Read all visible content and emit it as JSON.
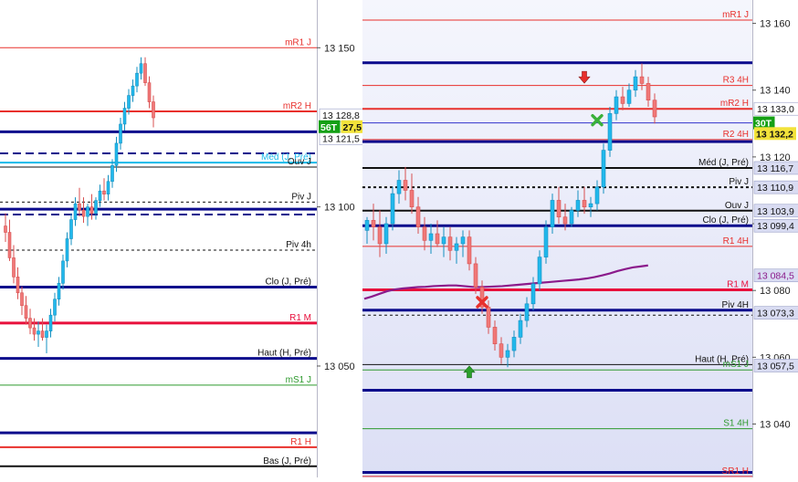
{
  "chart_data": [
    {
      "type": "candlestick",
      "title": "",
      "ylim": [
        13015,
        13165
      ],
      "y_ticks": [
        "13 150",
        "13 100",
        "13 050"
      ],
      "levels": [
        {
          "label": "mR1 J",
          "value": 13150,
          "color": "#e8302c",
          "width": 1,
          "style": "solid"
        },
        {
          "label": "mR2 H",
          "value": 13130,
          "color": "#e8302c",
          "width": 2,
          "style": "solid"
        },
        {
          "label": "",
          "value": 13123.6,
          "color": "#0a0a8c",
          "width": 3,
          "style": "solid"
        },
        {
          "label": "",
          "value": 13116.8,
          "color": "#0a0a8c",
          "width": 2,
          "style": "dash"
        },
        {
          "label": "Méd (J, Pré)",
          "value": 13113.9,
          "color": "#18b8e8",
          "width": 2,
          "style": "solid"
        },
        {
          "label": "Ouv J",
          "value": 13112.5,
          "color": "#111111",
          "width": 1,
          "style": "solid"
        },
        {
          "label": "Piv J",
          "value": 13101.5,
          "color": "#111111",
          "width": 1,
          "style": "dot"
        },
        {
          "label": "",
          "value": 13099.3,
          "color": "#0a0a8c",
          "width": 3,
          "style": "solid"
        },
        {
          "label": "",
          "value": 13097.6,
          "color": "#0a0a8c",
          "width": 2,
          "style": "dash"
        },
        {
          "label": "Piv 4h",
          "value": 13086.4,
          "color": "#111111",
          "width": 1,
          "style": "dot"
        },
        {
          "label": "Clo (J, Pré)",
          "value": 13074.8,
          "color": "#0a0a8c",
          "width": 3,
          "style": "solid"
        },
        {
          "label": "R1 M",
          "value": 13063.5,
          "color": "#e8103c",
          "width": 3,
          "style": "solid"
        },
        {
          "label": "Haut (H, Pré)",
          "value": 13052.4,
          "color": "#0a0a8c",
          "width": 3,
          "style": "solid"
        },
        {
          "label": "mS1 J",
          "value": 13044,
          "color": "#2e9a2e",
          "width": 1,
          "style": "solid"
        },
        {
          "label": "",
          "value": 13029,
          "color": "#0a0a8c",
          "width": 3,
          "style": "solid"
        },
        {
          "label": "R1 H",
          "value": 13024.5,
          "color": "#e8302c",
          "width": 2,
          "style": "solid"
        },
        {
          "label": "Bas (J, Pré)",
          "value": 13018.5,
          "color": "#111111",
          "width": 2,
          "style": "solid"
        }
      ],
      "price_tags": [
        {
          "text": "13 128,8",
          "value": 13128.8,
          "bg": "#ffffff",
          "fg": "#111111"
        },
        {
          "text": "13 121,5",
          "value": 13121.5,
          "bg": "#ffffff",
          "fg": "#111111"
        }
      ],
      "timer_badges": [
        {
          "text": "56T",
          "value": 13125.2,
          "bg": "#15a015",
          "fg": "#ffffff"
        },
        {
          "text": "27,5",
          "value": 13125.2,
          "bg": "#f2e23a",
          "fg": "#111111"
        }
      ],
      "candles": [
        {
          "o": 13094,
          "h": 13098,
          "l": 13089,
          "c": 13092
        },
        {
          "o": 13092,
          "h": 13096,
          "l": 13083,
          "c": 13084
        },
        {
          "o": 13084,
          "h": 13088,
          "l": 13076,
          "c": 13078
        },
        {
          "o": 13078,
          "h": 13081,
          "l": 13071,
          "c": 13073
        },
        {
          "o": 13073,
          "h": 13075,
          "l": 13066,
          "c": 13069
        },
        {
          "o": 13069,
          "h": 13072,
          "l": 13063,
          "c": 13065
        },
        {
          "o": 13065,
          "h": 13068,
          "l": 13060,
          "c": 13062
        },
        {
          "o": 13062,
          "h": 13065,
          "l": 13058,
          "c": 13060
        },
        {
          "o": 13060,
          "h": 13064,
          "l": 13056,
          "c": 13061
        },
        {
          "o": 13061,
          "h": 13065,
          "l": 13058,
          "c": 13059
        },
        {
          "o": 13059,
          "h": 13063,
          "l": 13054,
          "c": 13061
        },
        {
          "o": 13061,
          "h": 13068,
          "l": 13059,
          "c": 13066
        },
        {
          "o": 13066,
          "h": 13073,
          "l": 13064,
          "c": 13071
        },
        {
          "o": 13071,
          "h": 13078,
          "l": 13069,
          "c": 13076
        },
        {
          "o": 13076,
          "h": 13085,
          "l": 13074,
          "c": 13083
        },
        {
          "o": 13083,
          "h": 13092,
          "l": 13081,
          "c": 13090
        },
        {
          "o": 13090,
          "h": 13098,
          "l": 13088,
          "c": 13096
        },
        {
          "o": 13096,
          "h": 13103,
          "l": 13094,
          "c": 13101
        },
        {
          "o": 13101,
          "h": 13106,
          "l": 13097,
          "c": 13099
        },
        {
          "o": 13099,
          "h": 13103,
          "l": 13095,
          "c": 13097
        },
        {
          "o": 13097,
          "h": 13101,
          "l": 13094,
          "c": 13100
        },
        {
          "o": 13100,
          "h": 13104,
          "l": 13096,
          "c": 13098
        },
        {
          "o": 13098,
          "h": 13103,
          "l": 13096,
          "c": 13102
        },
        {
          "o": 13102,
          "h": 13107,
          "l": 13100,
          "c": 13105
        },
        {
          "o": 13105,
          "h": 13109,
          "l": 13102,
          "c": 13104
        },
        {
          "o": 13104,
          "h": 13110,
          "l": 13102,
          "c": 13108
        },
        {
          "o": 13108,
          "h": 13115,
          "l": 13106,
          "c": 13113
        },
        {
          "o": 13113,
          "h": 13122,
          "l": 13111,
          "c": 13120
        },
        {
          "o": 13120,
          "h": 13128,
          "l": 13118,
          "c": 13126
        },
        {
          "o": 13126,
          "h": 13133,
          "l": 13124,
          "c": 13131
        },
        {
          "o": 13131,
          "h": 13137,
          "l": 13129,
          "c": 13135
        },
        {
          "o": 13135,
          "h": 13140,
          "l": 13133,
          "c": 13138
        },
        {
          "o": 13138,
          "h": 13144,
          "l": 13136,
          "c": 13142
        },
        {
          "o": 13142,
          "h": 13147,
          "l": 13140,
          "c": 13145
        },
        {
          "o": 13145,
          "h": 13147,
          "l": 13138,
          "c": 13139
        },
        {
          "o": 13139,
          "h": 13141,
          "l": 13131,
          "c": 13133
        },
        {
          "o": 13133,
          "h": 13135,
          "l": 13125,
          "c": 13128
        }
      ]
    },
    {
      "type": "candlestick",
      "title": "",
      "ylim": [
        13024,
        13167
      ],
      "y_ticks": [
        "13 160",
        "13 140",
        "13 120",
        "13 100",
        "13 080",
        "13 060",
        "13 040"
      ],
      "levels": [
        {
          "label": "mR1 J",
          "value": 13161,
          "color": "#e8302c",
          "width": 1,
          "style": "solid"
        },
        {
          "label": "",
          "value": 13148.2,
          "color": "#0a0a8c",
          "width": 3,
          "style": "solid"
        },
        {
          "label": "R3 4H",
          "value": 13141.4,
          "color": "#e8302c",
          "width": 1,
          "style": "solid"
        },
        {
          "label": "mR2 H",
          "value": 13134.4,
          "color": "#e8302c",
          "width": 2,
          "style": "solid"
        },
        {
          "label": "",
          "value": 13130.2,
          "color": "#3333cc",
          "width": 1,
          "style": "solid"
        },
        {
          "label": "R2 4H",
          "value": 13125.2,
          "color": "#e8302c",
          "width": 1,
          "style": "solid"
        },
        {
          "label": "",
          "value": 13124.6,
          "color": "#0a0a8c",
          "width": 3,
          "style": "solid"
        },
        {
          "label": "Méd (J, Pré)",
          "value": 13116.7,
          "color": "#111111",
          "width": 2,
          "style": "solid"
        },
        {
          "label": "Piv J",
          "value": 13110.9,
          "color": "#111111",
          "width": 2,
          "style": "dot"
        },
        {
          "label": "Ouv J",
          "value": 13103.9,
          "color": "#111111",
          "width": 2,
          "style": "solid"
        },
        {
          "label": "Clo (J, Pré)",
          "value": 13099.4,
          "color": "#0a0a8c",
          "width": 3,
          "style": "solid"
        },
        {
          "label": "R1 4H",
          "value": 13093.2,
          "color": "#e8302c",
          "width": 1,
          "style": "solid"
        },
        {
          "label": "R1 M",
          "value": 13080.2,
          "color": "#e8103c",
          "width": 3,
          "style": "solid"
        },
        {
          "label": "Piv 4H",
          "value": 13074.1,
          "color": "#0a0a8c",
          "width": 3,
          "style": "solid"
        },
        {
          "label": "",
          "value": 13072.6,
          "color": "#111111",
          "width": 1,
          "style": "dot"
        },
        {
          "label": "Haut (H, Pré)",
          "value": 13057.8,
          "color": "#111111",
          "width": 1,
          "style": "solid"
        },
        {
          "label": "mS1 J",
          "value": 13056.2,
          "color": "#2e9a2e",
          "width": 1,
          "style": "solid"
        },
        {
          "label": "",
          "value": 13050.1,
          "color": "#0a0a8c",
          "width": 3,
          "style": "solid"
        },
        {
          "label": "S1 4H",
          "value": 13038.6,
          "color": "#2e9a2e",
          "width": 1,
          "style": "solid"
        },
        {
          "label": "",
          "value": 13025.5,
          "color": "#0a0a8c",
          "width": 3,
          "style": "solid"
        },
        {
          "label": "SR1 H",
          "value": 13024.3,
          "color": "#e8302c",
          "width": 1,
          "style": "solid"
        }
      ],
      "price_tags": [
        {
          "text": "13 133,0",
          "value": 13134.4,
          "bg": "#ffffff",
          "fg": "#111111"
        },
        {
          "text": "13 116,7",
          "value": 13116.7,
          "bg": "#d9dcf2",
          "fg": "#111111"
        },
        {
          "text": "13 110,9",
          "value": 13110.9,
          "bg": "#d9dcf2",
          "fg": "#111111"
        },
        {
          "text": "13 103,9",
          "value": 13103.9,
          "bg": "#d9dcf2",
          "fg": "#111111"
        },
        {
          "text": "13 099,4",
          "value": 13099.4,
          "bg": "#d9dcf2",
          "fg": "#111111"
        },
        {
          "text": "13 084,5",
          "value": 13084.5,
          "bg": "#d9dcf2",
          "fg": "#8b1a8b"
        },
        {
          "text": "13 073,3",
          "value": 13073.3,
          "bg": "#d9dcf2",
          "fg": "#111111"
        },
        {
          "text": "13 057,5",
          "value": 13057.5,
          "bg": "#d9dcf2",
          "fg": "#111111"
        }
      ],
      "timer_badges": [
        {
          "text": "30T",
          "value": 13130.2,
          "bg": "#15a015",
          "fg": "#ffffff"
        },
        {
          "text": "13 132,2",
          "value": 13127.0,
          "bg": "#f2e23a",
          "fg": "#111111"
        }
      ],
      "moving_average": {
        "color": "#8b1a8b",
        "values": [
          13077.5,
          13078.2,
          13079,
          13079.8,
          13080.3,
          13080.6,
          13080.8,
          13081,
          13081.1,
          13081.3,
          13081.4,
          13081.5,
          13081.5,
          13081.3,
          13081.1,
          13081,
          13081.1,
          13081.2,
          13081.3,
          13081.5,
          13081.7,
          13081.9,
          13082.1,
          13082.3,
          13082.5,
          13082.7,
          13082.9,
          13083.1,
          13083.3,
          13083.6,
          13084,
          13084.5,
          13085.1,
          13085.8,
          13086.4,
          13086.9,
          13087.2,
          13087.5
        ]
      },
      "markers": [
        {
          "type": "up-arrow",
          "candle": 16,
          "value": 13055.5,
          "color": "#2ca02c"
        },
        {
          "type": "x",
          "candle": 18,
          "value": 13076.5,
          "color": "#e8302c"
        },
        {
          "type": "down-arrow",
          "candle": 34,
          "value": 13144,
          "color": "#e8302c"
        },
        {
          "type": "x",
          "candle": 36,
          "value": 13131,
          "color": "#3ab03a"
        }
      ],
      "candles": [
        {
          "o": 13098,
          "h": 13102,
          "l": 13094,
          "c": 13101
        },
        {
          "o": 13101,
          "h": 13106,
          "l": 13095,
          "c": 13099
        },
        {
          "o": 13099,
          "h": 13104,
          "l": 13090,
          "c": 13094
        },
        {
          "o": 13094,
          "h": 13102,
          "l": 13091,
          "c": 13100
        },
        {
          "o": 13100,
          "h": 13111,
          "l": 13098,
          "c": 13109
        },
        {
          "o": 13109,
          "h": 13116,
          "l": 13106,
          "c": 13113
        },
        {
          "o": 13113,
          "h": 13117,
          "l": 13107,
          "c": 13110
        },
        {
          "o": 13110,
          "h": 13115,
          "l": 13103,
          "c": 13105
        },
        {
          "o": 13105,
          "h": 13108,
          "l": 13097,
          "c": 13099
        },
        {
          "o": 13099,
          "h": 13102,
          "l": 13092,
          "c": 13095
        },
        {
          "o": 13095,
          "h": 13100,
          "l": 13091,
          "c": 13097
        },
        {
          "o": 13097,
          "h": 13101,
          "l": 13093,
          "c": 13094
        },
        {
          "o": 13094,
          "h": 13099,
          "l": 13090,
          "c": 13096
        },
        {
          "o": 13096,
          "h": 13099,
          "l": 13089,
          "c": 13092
        },
        {
          "o": 13092,
          "h": 13096,
          "l": 13088,
          "c": 13094
        },
        {
          "o": 13094,
          "h": 13098,
          "l": 13090,
          "c": 13096
        },
        {
          "o": 13096,
          "h": 13098,
          "l": 13086,
          "c": 13088
        },
        {
          "o": 13088,
          "h": 13090,
          "l": 13079,
          "c": 13081
        },
        {
          "o": 13081,
          "h": 13083,
          "l": 13073,
          "c": 13075
        },
        {
          "o": 13075,
          "h": 13077,
          "l": 13067,
          "c": 13069
        },
        {
          "o": 13069,
          "h": 13071,
          "l": 13062,
          "c": 13064
        },
        {
          "o": 13064,
          "h": 13066,
          "l": 13058,
          "c": 13060
        },
        {
          "o": 13060,
          "h": 13064,
          "l": 13057,
          "c": 13062
        },
        {
          "o": 13062,
          "h": 13068,
          "l": 13060,
          "c": 13066
        },
        {
          "o": 13066,
          "h": 13073,
          "l": 13064,
          "c": 13071
        },
        {
          "o": 13071,
          "h": 13078,
          "l": 13069,
          "c": 13076
        },
        {
          "o": 13076,
          "h": 13084,
          "l": 13074,
          "c": 13082
        },
        {
          "o": 13082,
          "h": 13092,
          "l": 13080,
          "c": 13090
        },
        {
          "o": 13090,
          "h": 13101,
          "l": 13088,
          "c": 13099
        },
        {
          "o": 13099,
          "h": 13109,
          "l": 13097,
          "c": 13107
        },
        {
          "o": 13107,
          "h": 13111,
          "l": 13100,
          "c": 13102
        },
        {
          "o": 13102,
          "h": 13106,
          "l": 13098,
          "c": 13100
        },
        {
          "o": 13100,
          "h": 13105,
          "l": 13099,
          "c": 13104
        },
        {
          "o": 13104,
          "h": 13110,
          "l": 13102,
          "c": 13107
        },
        {
          "o": 13107,
          "h": 13111,
          "l": 13103,
          "c": 13105
        },
        {
          "o": 13105,
          "h": 13108,
          "l": 13102,
          "c": 13106
        },
        {
          "o": 13106,
          "h": 13113,
          "l": 13104,
          "c": 13111
        },
        {
          "o": 13111,
          "h": 13124,
          "l": 13109,
          "c": 13122
        },
        {
          "o": 13122,
          "h": 13135,
          "l": 13120,
          "c": 13133
        },
        {
          "o": 13133,
          "h": 13140,
          "l": 13131,
          "c": 13138
        },
        {
          "o": 13138,
          "h": 13141,
          "l": 13134,
          "c": 13136
        },
        {
          "o": 13136,
          "h": 13142,
          "l": 13135,
          "c": 13140
        },
        {
          "o": 13140,
          "h": 13146,
          "l": 13138,
          "c": 13144
        },
        {
          "o": 13144,
          "h": 13148,
          "l": 13140,
          "c": 13142
        },
        {
          "o": 13142,
          "h": 13144,
          "l": 13135,
          "c": 13137
        },
        {
          "o": 13137,
          "h": 13139,
          "l": 13130,
          "c": 13132
        }
      ]
    }
  ]
}
